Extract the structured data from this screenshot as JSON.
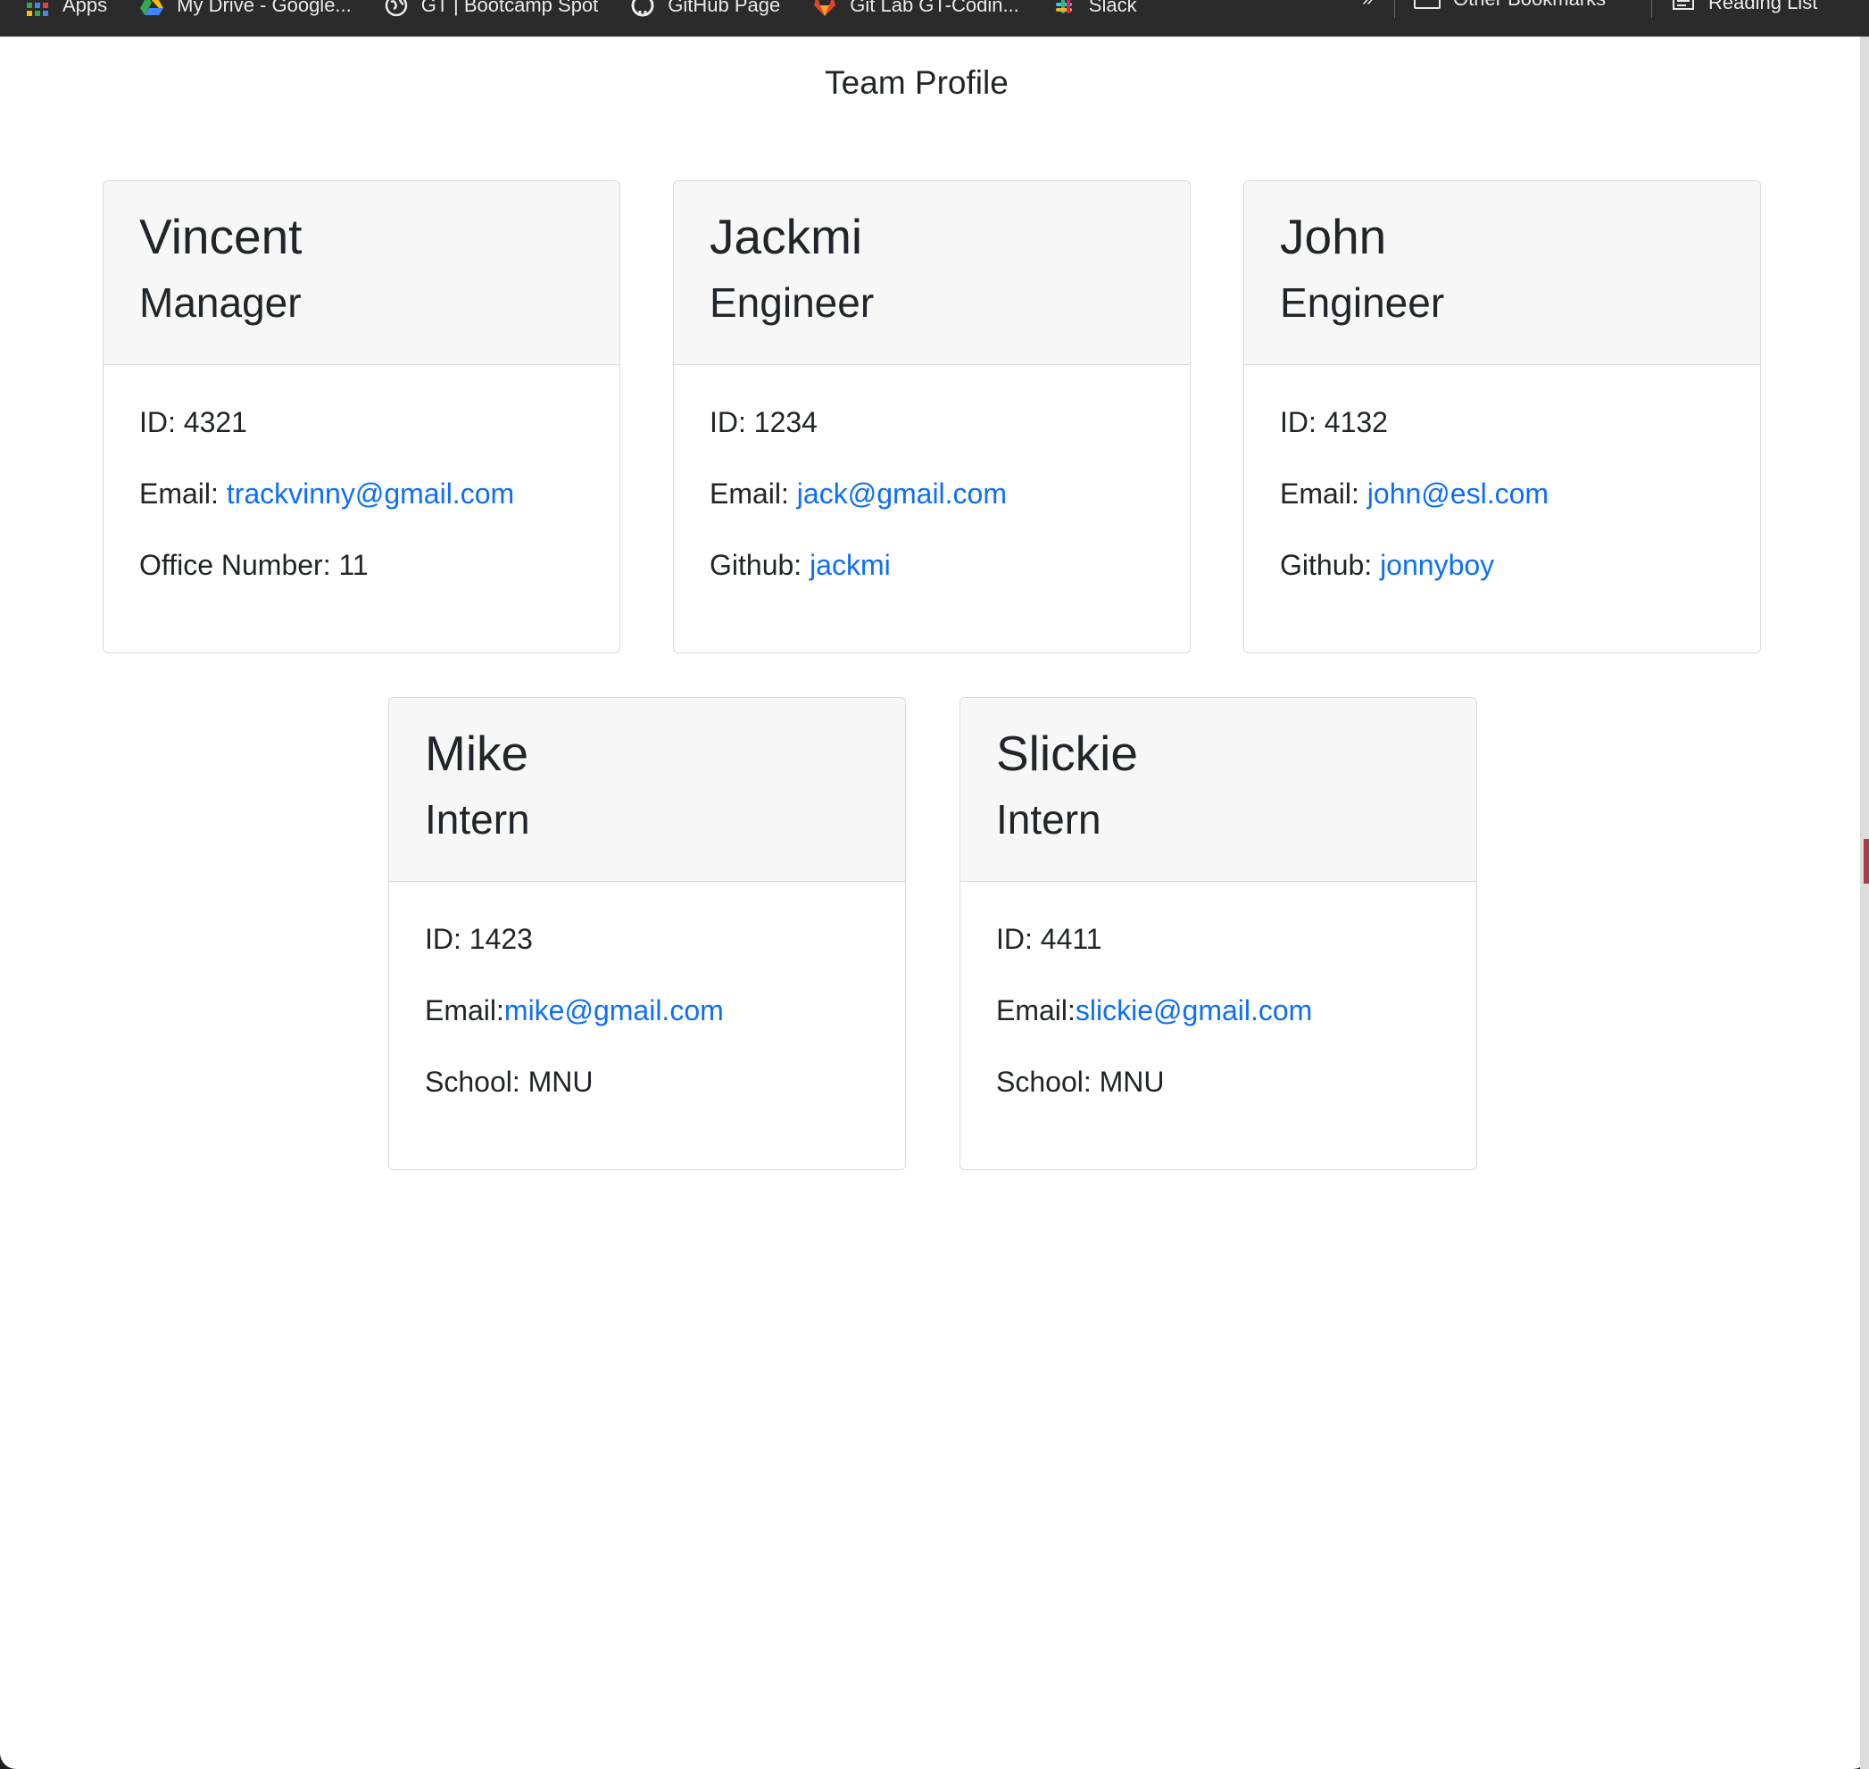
{
  "bookmarks": {
    "items": [
      {
        "label": "Apps",
        "icon": "apps-grid-icon"
      },
      {
        "label": "My Drive - Google...",
        "icon": "google-drive-icon"
      },
      {
        "label": "GT | Bootcamp Spot",
        "icon": "globe-icon"
      },
      {
        "label": "GitHub Page",
        "icon": "github-icon"
      },
      {
        "label": "Git Lab GT-Codin...",
        "icon": "gitlab-icon"
      },
      {
        "label": "Slack",
        "icon": "slack-icon"
      }
    ],
    "overflow_label": "»",
    "other_bookmarks": "Other Bookmarks",
    "reading_list": "Reading List"
  },
  "page": {
    "title": "Team Profile"
  },
  "cards": [
    {
      "name": "Vincent",
      "role": "Manager",
      "id_label": "ID: ",
      "id": "4321",
      "email_label": "Email: ",
      "email": "trackvinny@gmail.com",
      "extra_label": "Office Number: ",
      "extra": "11"
    },
    {
      "name": "Jackmi",
      "role": "Engineer",
      "id_label": "ID: ",
      "id": "1234",
      "email_label": "Email: ",
      "email": "jack@gmail.com",
      "extra_label": "Github: ",
      "extra": "jackmi"
    },
    {
      "name": "John",
      "role": "Engineer",
      "id_label": "ID: ",
      "id": "4132",
      "email_label": "Email: ",
      "email": "john@esl.com",
      "extra_label": "Github: ",
      "extra": "jonnyboy"
    },
    {
      "name": "Mike",
      "role": "Intern",
      "id_label": "ID: ",
      "id": "1423",
      "email_label": "Email:",
      "email": "mike@gmail.com",
      "extra_label": "School: ",
      "extra": "MNU"
    },
    {
      "name": "Slickie",
      "role": "Intern",
      "id_label": "ID: ",
      "id": "4411",
      "email_label": "Email:",
      "email": "slickie@gmail.com",
      "extra_label": "School: ",
      "extra": "MNU"
    }
  ],
  "colors": {
    "link": "#0d6efd",
    "card_header_bg": "#f7f7f7",
    "bookmarks_bar_bg": "#2b2b2b"
  }
}
